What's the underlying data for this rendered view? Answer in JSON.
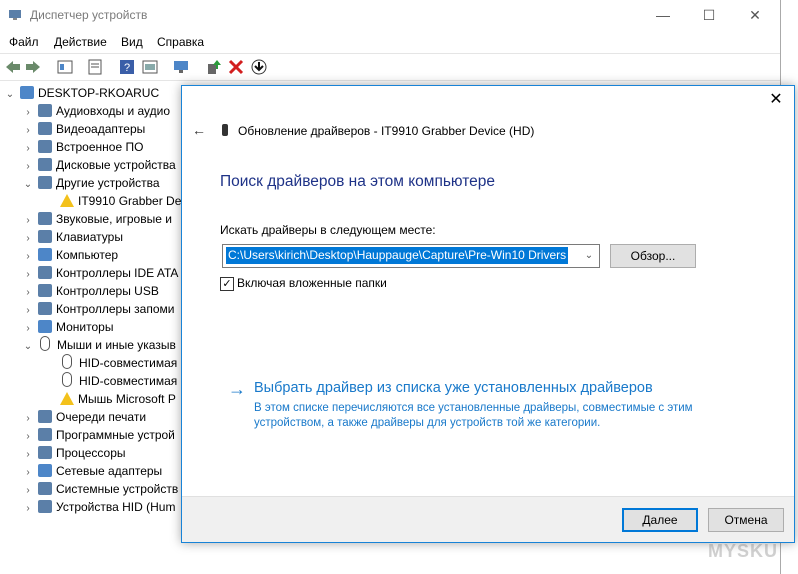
{
  "device_manager": {
    "title": "Диспетчер устройств",
    "window_buttons": {
      "minimize": "—",
      "maximize": "☐",
      "close": "✕"
    },
    "menu": [
      "Файл",
      "Действие",
      "Вид",
      "Справка"
    ],
    "tree": {
      "root": "DESKTOP-RKOARUC",
      "items": [
        "Аудиовходы и аудио",
        "Видеоадаптеры",
        "Встроенное ПО",
        "Дисковые устройства",
        "Другие устройства",
        "IT9910 Grabber Dev",
        "Звуковые, игровые и",
        "Клавиатуры",
        "Компьютер",
        "Контроллеры IDE ATA",
        "Контроллеры USB",
        "Контроллеры запоми",
        "Мониторы",
        "Мыши и иные указыв",
        "HID-совместимая",
        "HID-совместимая",
        "Мышь Microsoft P",
        "Очереди печати",
        "Программные устрой",
        "Процессоры",
        "Сетевые адаптеры",
        "Системные устройств",
        "Устройства HID (Hum"
      ]
    }
  },
  "dialog": {
    "close": "✕",
    "back": "←",
    "title": "Обновление драйверов - IT9910 Grabber Device (HD)",
    "heading": "Поиск драйверов на этом компьютере",
    "search_label": "Искать драйверы в следующем месте:",
    "path_value": "C:\\Users\\kirich\\Desktop\\Hauppauge\\Capture\\Pre-Win10 Drivers",
    "browse_button": "Обзор...",
    "include_subfolders_label": "Включая вложенные папки",
    "include_subfolders_checked": "✓",
    "pick_arrow": "→",
    "pick_link": "Выбрать драйвер из списка уже установленных драйверов",
    "pick_description": "В этом списке перечисляются все установленные драйверы, совместимые с этим устройством, а также драйверы для устройств той же категории.",
    "next_button": "Далее",
    "cancel_button": "Отмена"
  },
  "watermark": "MYSKU",
  "colors": {
    "accent": "#0078d7",
    "link": "#1979ca",
    "heading": "#1e3287"
  }
}
